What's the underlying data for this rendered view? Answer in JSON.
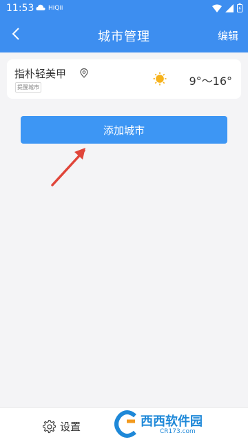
{
  "status_bar": {
    "time": "11:53",
    "app_icons": "HiQii"
  },
  "header": {
    "title": "城市管理",
    "edit_label": "编辑",
    "back_icon": "chevron-left-icon"
  },
  "city_list": [
    {
      "name": "指朴轻美甲",
      "tag": "提醒城市",
      "weather_icon": "sun-icon",
      "temperature": "9°～16°"
    }
  ],
  "add_city_label": "添加城市",
  "footer": {
    "settings_label": "设置",
    "settings_icon": "gear-icon"
  },
  "watermark": {
    "text": "西西软件园",
    "sub": "CR173.com"
  },
  "colors": {
    "header_bg": "#3d8ef0",
    "button_bg": "#3d96f4",
    "annotation_arrow": "#e0453a",
    "sun": "#f6b21b"
  }
}
